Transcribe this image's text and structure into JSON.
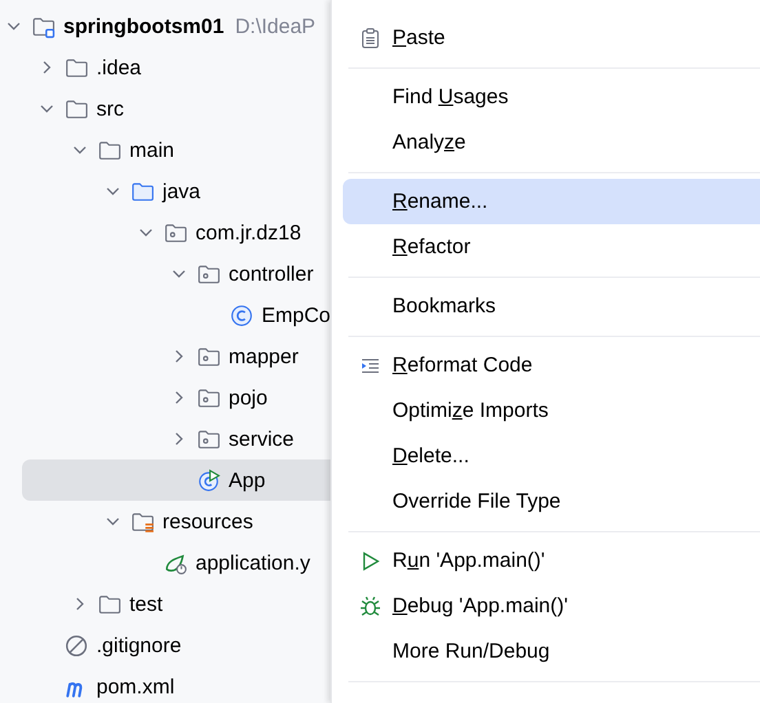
{
  "project_tree": [
    {
      "label": "springbootsm01",
      "path": "D:\\IdeaP",
      "kind": "module",
      "expanded": true,
      "selected": false,
      "children": [
        {
          "label": ".idea",
          "kind": "folder",
          "expanded": false,
          "selected": false
        },
        {
          "label": "src",
          "kind": "folder",
          "expanded": true,
          "selected": false,
          "children": [
            {
              "label": "main",
              "kind": "folder",
              "expanded": true,
              "selected": false,
              "children": [
                {
                  "label": "java",
                  "kind": "source-folder",
                  "expanded": true,
                  "selected": false,
                  "children": [
                    {
                      "label": "com.jr.dz18",
                      "kind": "package",
                      "expanded": true,
                      "selected": false,
                      "children": [
                        {
                          "label": "controller",
                          "kind": "package",
                          "expanded": true,
                          "selected": false,
                          "children": [
                            {
                              "label": "EmpCo",
                              "kind": "class",
                              "selected": false
                            }
                          ]
                        },
                        {
                          "label": "mapper",
                          "kind": "package",
                          "expanded": false,
                          "selected": false
                        },
                        {
                          "label": "pojo",
                          "kind": "package",
                          "expanded": false,
                          "selected": false
                        },
                        {
                          "label": "service",
                          "kind": "package",
                          "expanded": false,
                          "selected": false
                        },
                        {
                          "label": "App",
                          "kind": "app-class",
                          "selected": true
                        }
                      ]
                    }
                  ]
                },
                {
                  "label": "resources",
                  "kind": "resources-folder",
                  "expanded": true,
                  "selected": false,
                  "children": [
                    {
                      "label": "application.y",
                      "kind": "spring-config",
                      "selected": false
                    }
                  ]
                }
              ]
            },
            {
              "label": "test",
              "kind": "folder",
              "expanded": false,
              "selected": false
            }
          ]
        },
        {
          "label": ".gitignore",
          "kind": "ignore-file",
          "selected": false
        },
        {
          "label": "pom.xml",
          "kind": "maven",
          "selected": false
        }
      ]
    }
  ],
  "context_menu": {
    "groups": [
      [
        {
          "key": "P",
          "rest": "aste",
          "kind": "paste",
          "selected": false
        }
      ],
      [
        {
          "lead": "Find ",
          "key": "U",
          "rest": "sages",
          "selected": false
        },
        {
          "lead": "Analy",
          "key": "z",
          "rest": "e",
          "selected": false
        }
      ],
      [
        {
          "key": "R",
          "rest": "ename...",
          "selected": true
        },
        {
          "key": "R",
          "rest": "efactor",
          "selected": false
        }
      ],
      [
        {
          "lead": "Bookmarks",
          "selected": false
        }
      ],
      [
        {
          "key": "R",
          "rest": "eformat Code",
          "kind": "reformat",
          "selected": false
        },
        {
          "lead": "Optimi",
          "key": "z",
          "rest": "e Imports",
          "selected": false
        },
        {
          "key": "D",
          "rest": "elete...",
          "selected": false
        },
        {
          "lead": "Override File Type",
          "selected": false
        }
      ],
      [
        {
          "lead": "R",
          "key": "u",
          "rest": "n 'App.main()'",
          "kind": "run",
          "selected": false
        },
        {
          "key": "D",
          "rest": "ebug 'App.main()'",
          "kind": "debug",
          "selected": false
        },
        {
          "lead": "More Run/Debug",
          "selected": false
        }
      ]
    ]
  }
}
